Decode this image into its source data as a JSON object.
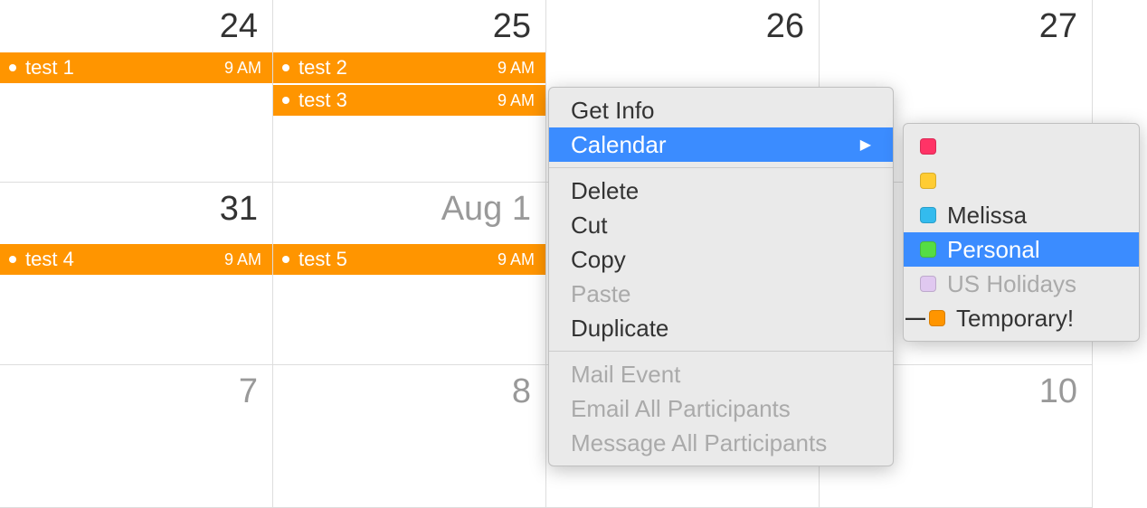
{
  "weeks": [
    {
      "days": [
        {
          "label": "24",
          "dimmed": false,
          "events": [
            {
              "title": "test 1",
              "time": "9 AM"
            }
          ]
        },
        {
          "label": "25",
          "dimmed": false,
          "events": [
            {
              "title": "test 2",
              "time": "9 AM"
            },
            {
              "title": "test 3",
              "time": "9 AM"
            }
          ]
        },
        {
          "label": "26",
          "dimmed": false,
          "events": []
        },
        {
          "label": "27",
          "dimmed": false,
          "events": []
        }
      ]
    },
    {
      "days": [
        {
          "label": "31",
          "dimmed": false,
          "events": [
            {
              "title": "test 4",
              "time": "9 AM"
            }
          ]
        },
        {
          "label": "Aug 1",
          "dimmed": true,
          "events": [
            {
              "title": "test 5",
              "time": "9 AM"
            }
          ]
        },
        {
          "label": "",
          "dimmed": false,
          "events": []
        },
        {
          "label": "",
          "dimmed": false,
          "events": []
        }
      ]
    },
    {
      "days": [
        {
          "label": "7",
          "dimmed": true,
          "events": []
        },
        {
          "label": "8",
          "dimmed": true,
          "events": []
        },
        {
          "label": "",
          "dimmed": false,
          "events": []
        },
        {
          "label": "10",
          "dimmed": true,
          "events": []
        }
      ]
    }
  ],
  "context_menu": {
    "items": [
      {
        "label": "Get Info",
        "submenu": false,
        "disabled": false,
        "highlighted": false
      },
      {
        "label": "Calendar",
        "submenu": true,
        "disabled": false,
        "highlighted": true
      },
      "divider",
      {
        "label": "Delete",
        "submenu": false,
        "disabled": false,
        "highlighted": false
      },
      {
        "label": "Cut",
        "submenu": false,
        "disabled": false,
        "highlighted": false
      },
      {
        "label": "Copy",
        "submenu": false,
        "disabled": false,
        "highlighted": false
      },
      {
        "label": "Paste",
        "submenu": false,
        "disabled": true,
        "highlighted": false
      },
      {
        "label": "Duplicate",
        "submenu": false,
        "disabled": false,
        "highlighted": false
      },
      "divider",
      {
        "label": "Mail Event",
        "submenu": false,
        "disabled": true,
        "highlighted": false
      },
      {
        "label": "Email All Participants",
        "submenu": false,
        "disabled": true,
        "highlighted": false
      },
      {
        "label": "Message All Participants",
        "submenu": false,
        "disabled": true,
        "highlighted": false
      }
    ]
  },
  "submenu": {
    "items": [
      {
        "color": "pink",
        "label": "",
        "highlighted": false,
        "disabled": false,
        "checked": false
      },
      {
        "color": "yellow",
        "label": "",
        "highlighted": false,
        "disabled": false,
        "checked": false
      },
      {
        "color": "blue",
        "label": "Melissa",
        "highlighted": false,
        "disabled": false,
        "checked": false
      },
      {
        "color": "green",
        "label": "Personal",
        "highlighted": true,
        "disabled": false,
        "checked": false
      },
      {
        "color": "lavender",
        "label": "US Holidays",
        "highlighted": false,
        "disabled": true,
        "checked": false
      },
      {
        "color": "orange",
        "label": "Temporary!",
        "highlighted": false,
        "disabled": false,
        "checked": true
      }
    ]
  },
  "event_color": "#ff9500",
  "highlight_color": "#3b8cff"
}
